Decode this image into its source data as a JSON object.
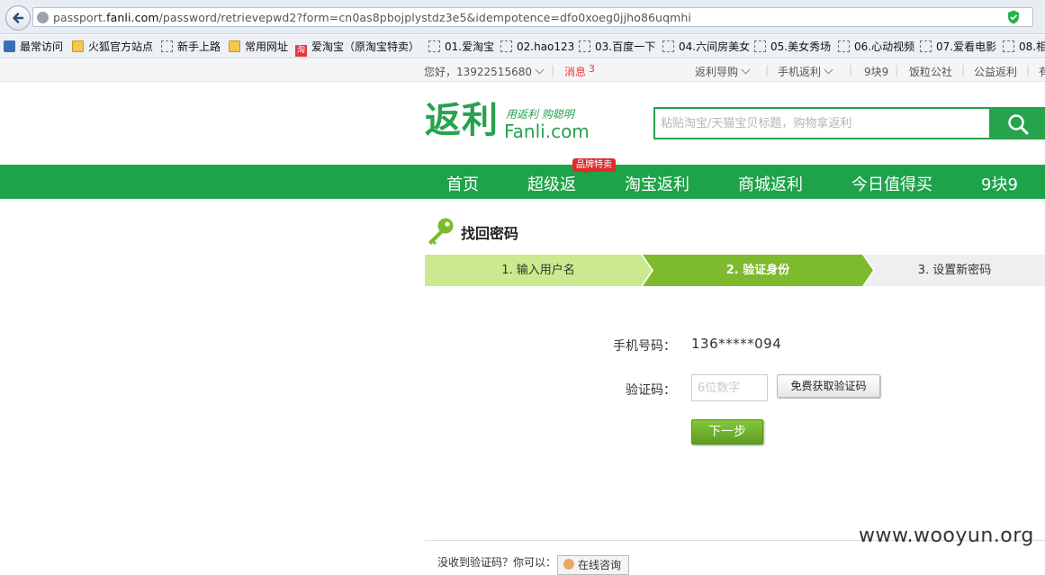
{
  "browser": {
    "url_prefix": "passport.",
    "url_domain": "fanli.com",
    "url_path": "/password/retrievepwd2?form=cn0as8pbojplystdz3e5&idempotence=dfo0xoeg0jjho86uqmhi"
  },
  "bookmarks": [
    {
      "label": "最常访问",
      "icon": "star-icon"
    },
    {
      "label": "火狐官方站点",
      "icon": "folder-icon"
    },
    {
      "label": "新手上路",
      "icon": "page-icon"
    },
    {
      "label": "常用网址",
      "icon": "folder-icon"
    },
    {
      "label": "爱淘宝（原淘宝特卖）",
      "icon": "taobao-icon"
    },
    {
      "label": "01.爱淘宝",
      "icon": "page-icon"
    },
    {
      "label": "02.hao123",
      "icon": "page-icon"
    },
    {
      "label": "03.百度一下",
      "icon": "page-icon"
    },
    {
      "label": "04.六间房美女",
      "icon": "page-icon"
    },
    {
      "label": "05.美女秀场",
      "icon": "page-icon"
    },
    {
      "label": "06.心动视频",
      "icon": "page-icon"
    },
    {
      "label": "07.爱看电影",
      "icon": "page-icon"
    },
    {
      "label": "08.相",
      "icon": "page-icon"
    }
  ],
  "topbar": {
    "greeting": "您好，13922515680",
    "messages": "消息",
    "message_count": "3",
    "links": [
      "返利导购",
      "手机返利",
      "9块9",
      "饭粒公社",
      "公益返利",
      "有"
    ]
  },
  "header": {
    "logo_text": "返利",
    "logo_slogan": "用返利 购聪明",
    "logo_domain": "Fanli.com",
    "search_placeholder": "粘贴淘宝/天猫宝贝标题，购物拿返利"
  },
  "nav": {
    "items": [
      "首页",
      "超级返",
      "淘宝返利",
      "商城返利",
      "今日值得买",
      "9块9"
    ],
    "badge": "品牌特卖"
  },
  "page": {
    "title": "找回密码",
    "steps": [
      "1. 输入用户名",
      "2. 验证身份",
      "3. 设置新密码"
    ],
    "active_step": 2
  },
  "form": {
    "phone_label": "手机号码：",
    "phone_value": "136*****094",
    "code_label": "验证码：",
    "code_placeholder": "6位数字",
    "get_code_button": "免费获取验证码",
    "next_button": "下一步"
  },
  "footer": {
    "hint_text": "没收到验证码？你可以：",
    "contact_button": "在线咨询"
  },
  "watermark": "www.wooyun.org",
  "colors": {
    "brand_green": "#1fa34a",
    "step_active": "#7dba2e",
    "step_done": "#cbe98e",
    "badge_red": "#e02b2b"
  }
}
